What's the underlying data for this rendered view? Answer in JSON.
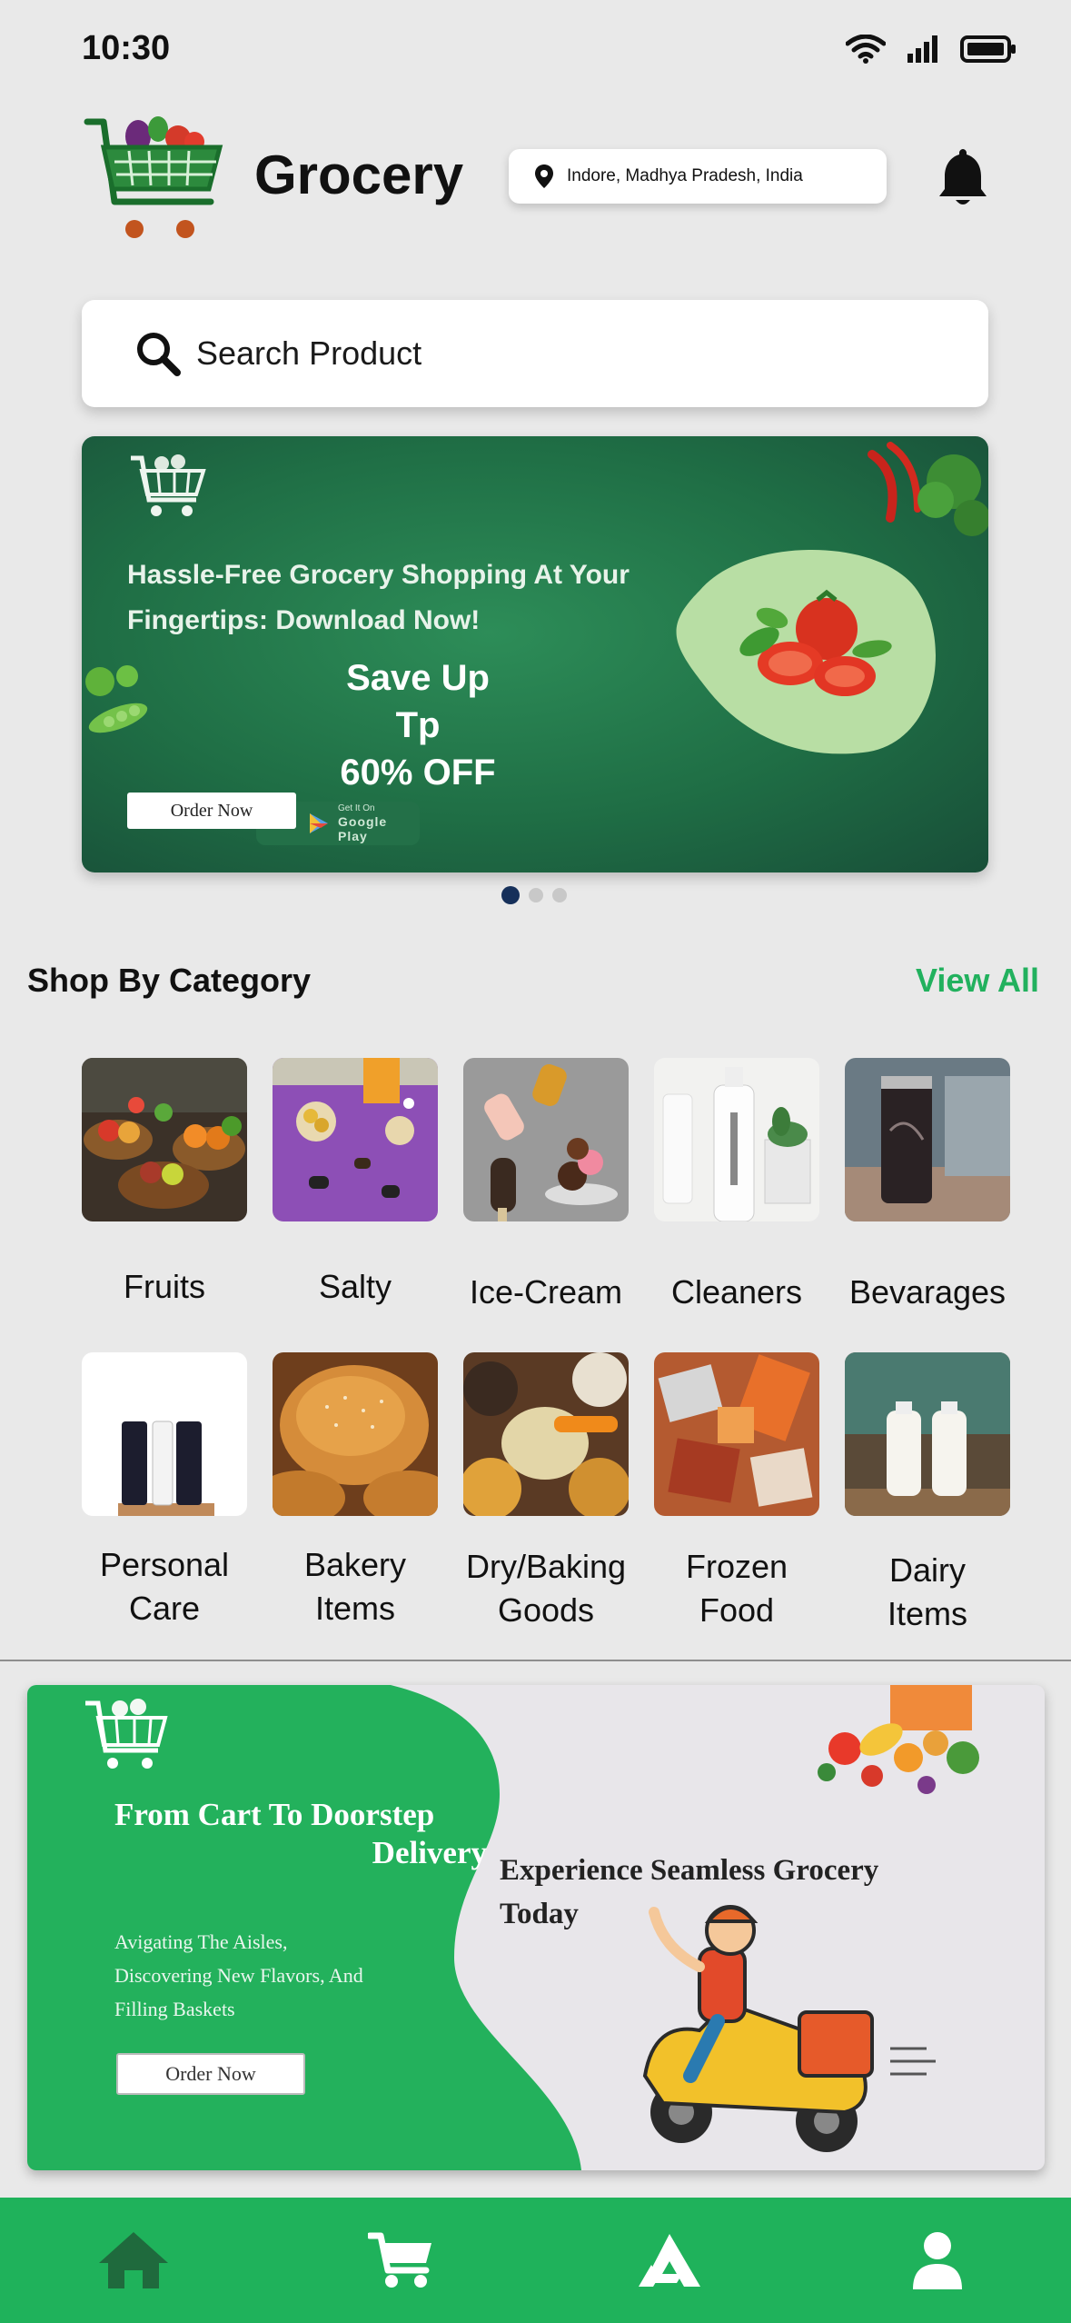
{
  "status": {
    "time": "10:30"
  },
  "header": {
    "title": "Grocery",
    "location": "Indore, Madhya Pradesh, India"
  },
  "search": {
    "placeholder": "Search Product"
  },
  "hero": {
    "headline_line1": "Hassle-Free Grocery Shopping At Your",
    "headline_line2": "Fingertips: Download Now!",
    "save_line1": "Save Up Tp",
    "save_line2": "60% OFF",
    "order_button": "Order Now",
    "gplay_small": "Get It On",
    "gplay_big": "Google Play"
  },
  "categories": {
    "title": "Shop By Category",
    "view_all": "View All",
    "items": [
      {
        "label": "Fruits"
      },
      {
        "label": "Salty"
      },
      {
        "label": "Ice-Cream"
      },
      {
        "label": "Cleaners"
      },
      {
        "label": "Bevarages"
      },
      {
        "label_l1": "Personal",
        "label_l2": "Care"
      },
      {
        "label_l1": "Bakery",
        "label_l2": "Items"
      },
      {
        "label_l1": "Dry/Baking",
        "label_l2": "Goods"
      },
      {
        "label_l1": "Frozen",
        "label_l2": "Food"
      },
      {
        "label_l1": "Dairy",
        "label_l2": "Items"
      }
    ]
  },
  "promo": {
    "heading_l1": "From Cart To Doorstep",
    "heading_l2": "Delivery",
    "sub_l1": "Avigating The Aisles,",
    "sub_l2": "Discovering New Flavors, And",
    "sub_l3": "Filling Baskets",
    "order_button": "Order Now",
    "heading2_l1": "Experience Seamless Grocery",
    "heading2_l2": "Today"
  },
  "nav": {
    "items": [
      "home-icon",
      "cart-icon",
      "brand-icon",
      "profile-icon"
    ]
  },
  "colors": {
    "accent": "#1fb25b",
    "hero_green": "#1f6e45",
    "view_all": "#22b15e"
  }
}
